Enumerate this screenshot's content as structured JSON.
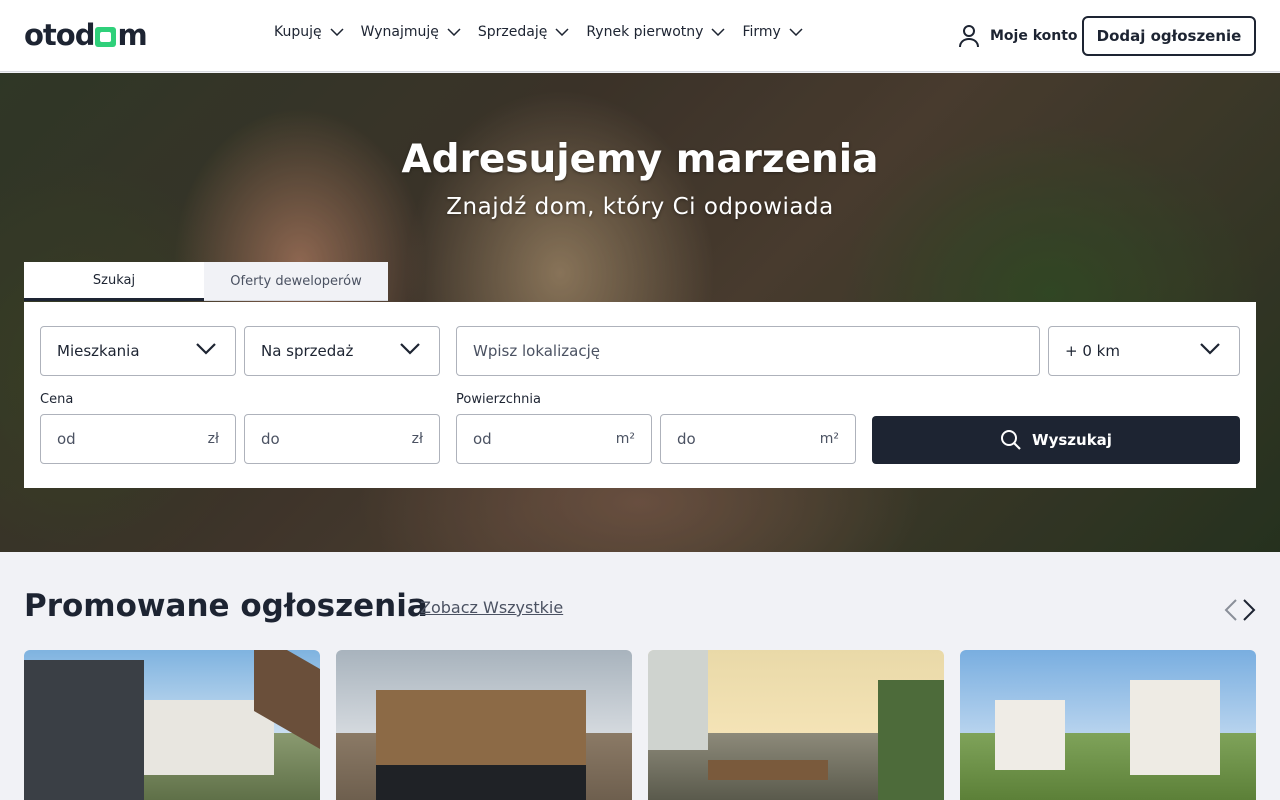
{
  "header": {
    "logo_text": "otodom",
    "nav": [
      {
        "label": "Kupuję"
      },
      {
        "label": "Wynajmuję"
      },
      {
        "label": "Sprzedaję"
      },
      {
        "label": "Rynek pierwotny"
      },
      {
        "label": "Firmy"
      }
    ],
    "account_label": "Moje konto",
    "add_listing_label": "Dodaj ogłoszenie"
  },
  "hero": {
    "title": "Adresujemy marzenia",
    "subtitle": "Znajdź dom, który Ci odpowiada"
  },
  "search": {
    "tabs": [
      {
        "label": "Szukaj",
        "active": true
      },
      {
        "label": "Oferty deweloperów",
        "active": false
      }
    ],
    "property_type": "Mieszkania",
    "transaction_type": "Na sprzedaż",
    "location_placeholder": "Wpisz lokalizację",
    "radius": "+ 0 km",
    "price_label": "Cena",
    "price_from_placeholder": "od",
    "price_to_placeholder": "do",
    "price_unit": "zł",
    "area_label": "Powierzchnia",
    "area_from_placeholder": "od",
    "area_to_placeholder": "do",
    "area_unit": "m²",
    "search_button": "Wyszukaj"
  },
  "promoted": {
    "title": "Promowane ogłoszenia",
    "see_all": "Zobacz Wszystkie"
  },
  "colors": {
    "brand_dark": "#1d2432",
    "brand_green": "#2fd07a",
    "page_bg": "#f1f2f6"
  }
}
